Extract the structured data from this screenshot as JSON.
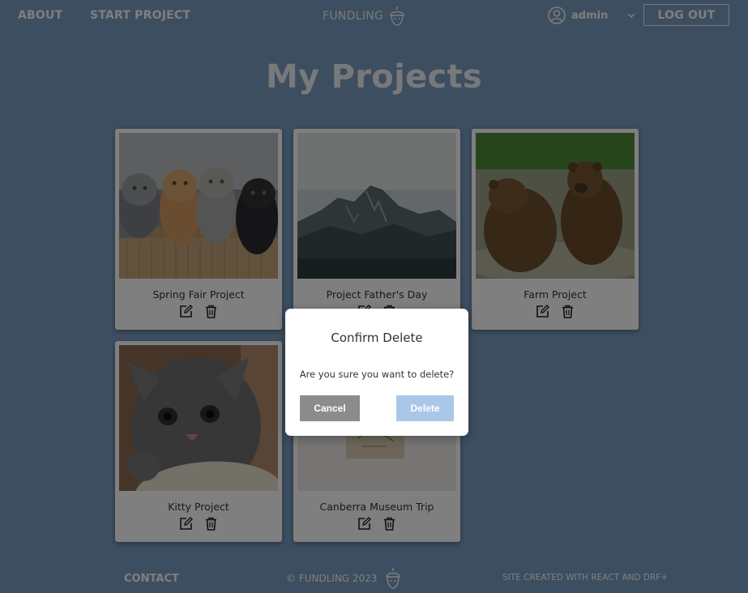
{
  "nav": {
    "about": "ABOUT",
    "start_project": "START PROJECT",
    "logo_text": "FUNDLING",
    "user_name": "admin",
    "logout": "LOG OUT"
  },
  "page_title": "My Projects",
  "projects": [
    {
      "title": "Spring Fair Project",
      "image": "kittens-in-basket-photo"
    },
    {
      "title": "Project Father's Day",
      "image": "misty-mountain-photo"
    },
    {
      "title": "Farm Project",
      "image": "bears-in-water-photo"
    },
    {
      "title": "Kitty Project",
      "image": "grey-kitten-photo"
    },
    {
      "title": "Canberra Museum Trip",
      "image": "museum-artifact-photo"
    }
  ],
  "footer": {
    "contact": "CONTACT",
    "copyright": "© FUNDLING 2023",
    "credit": "SITE CREATED WITH REACT AND DRF+"
  },
  "modal": {
    "title": "Confirm Delete",
    "message": "Are you sure you want to delete?",
    "cancel": "Cancel",
    "delete": "Delete"
  },
  "colors": {
    "background": "#7a9cc1",
    "cancel_button": "#8c8c8c",
    "delete_button": "#a9c8e8"
  },
  "icons": {
    "user": "user-circle-icon",
    "chevron": "chevron-down-icon",
    "edit": "edit-icon",
    "delete": "trash-icon",
    "logo": "acorn-icon"
  }
}
